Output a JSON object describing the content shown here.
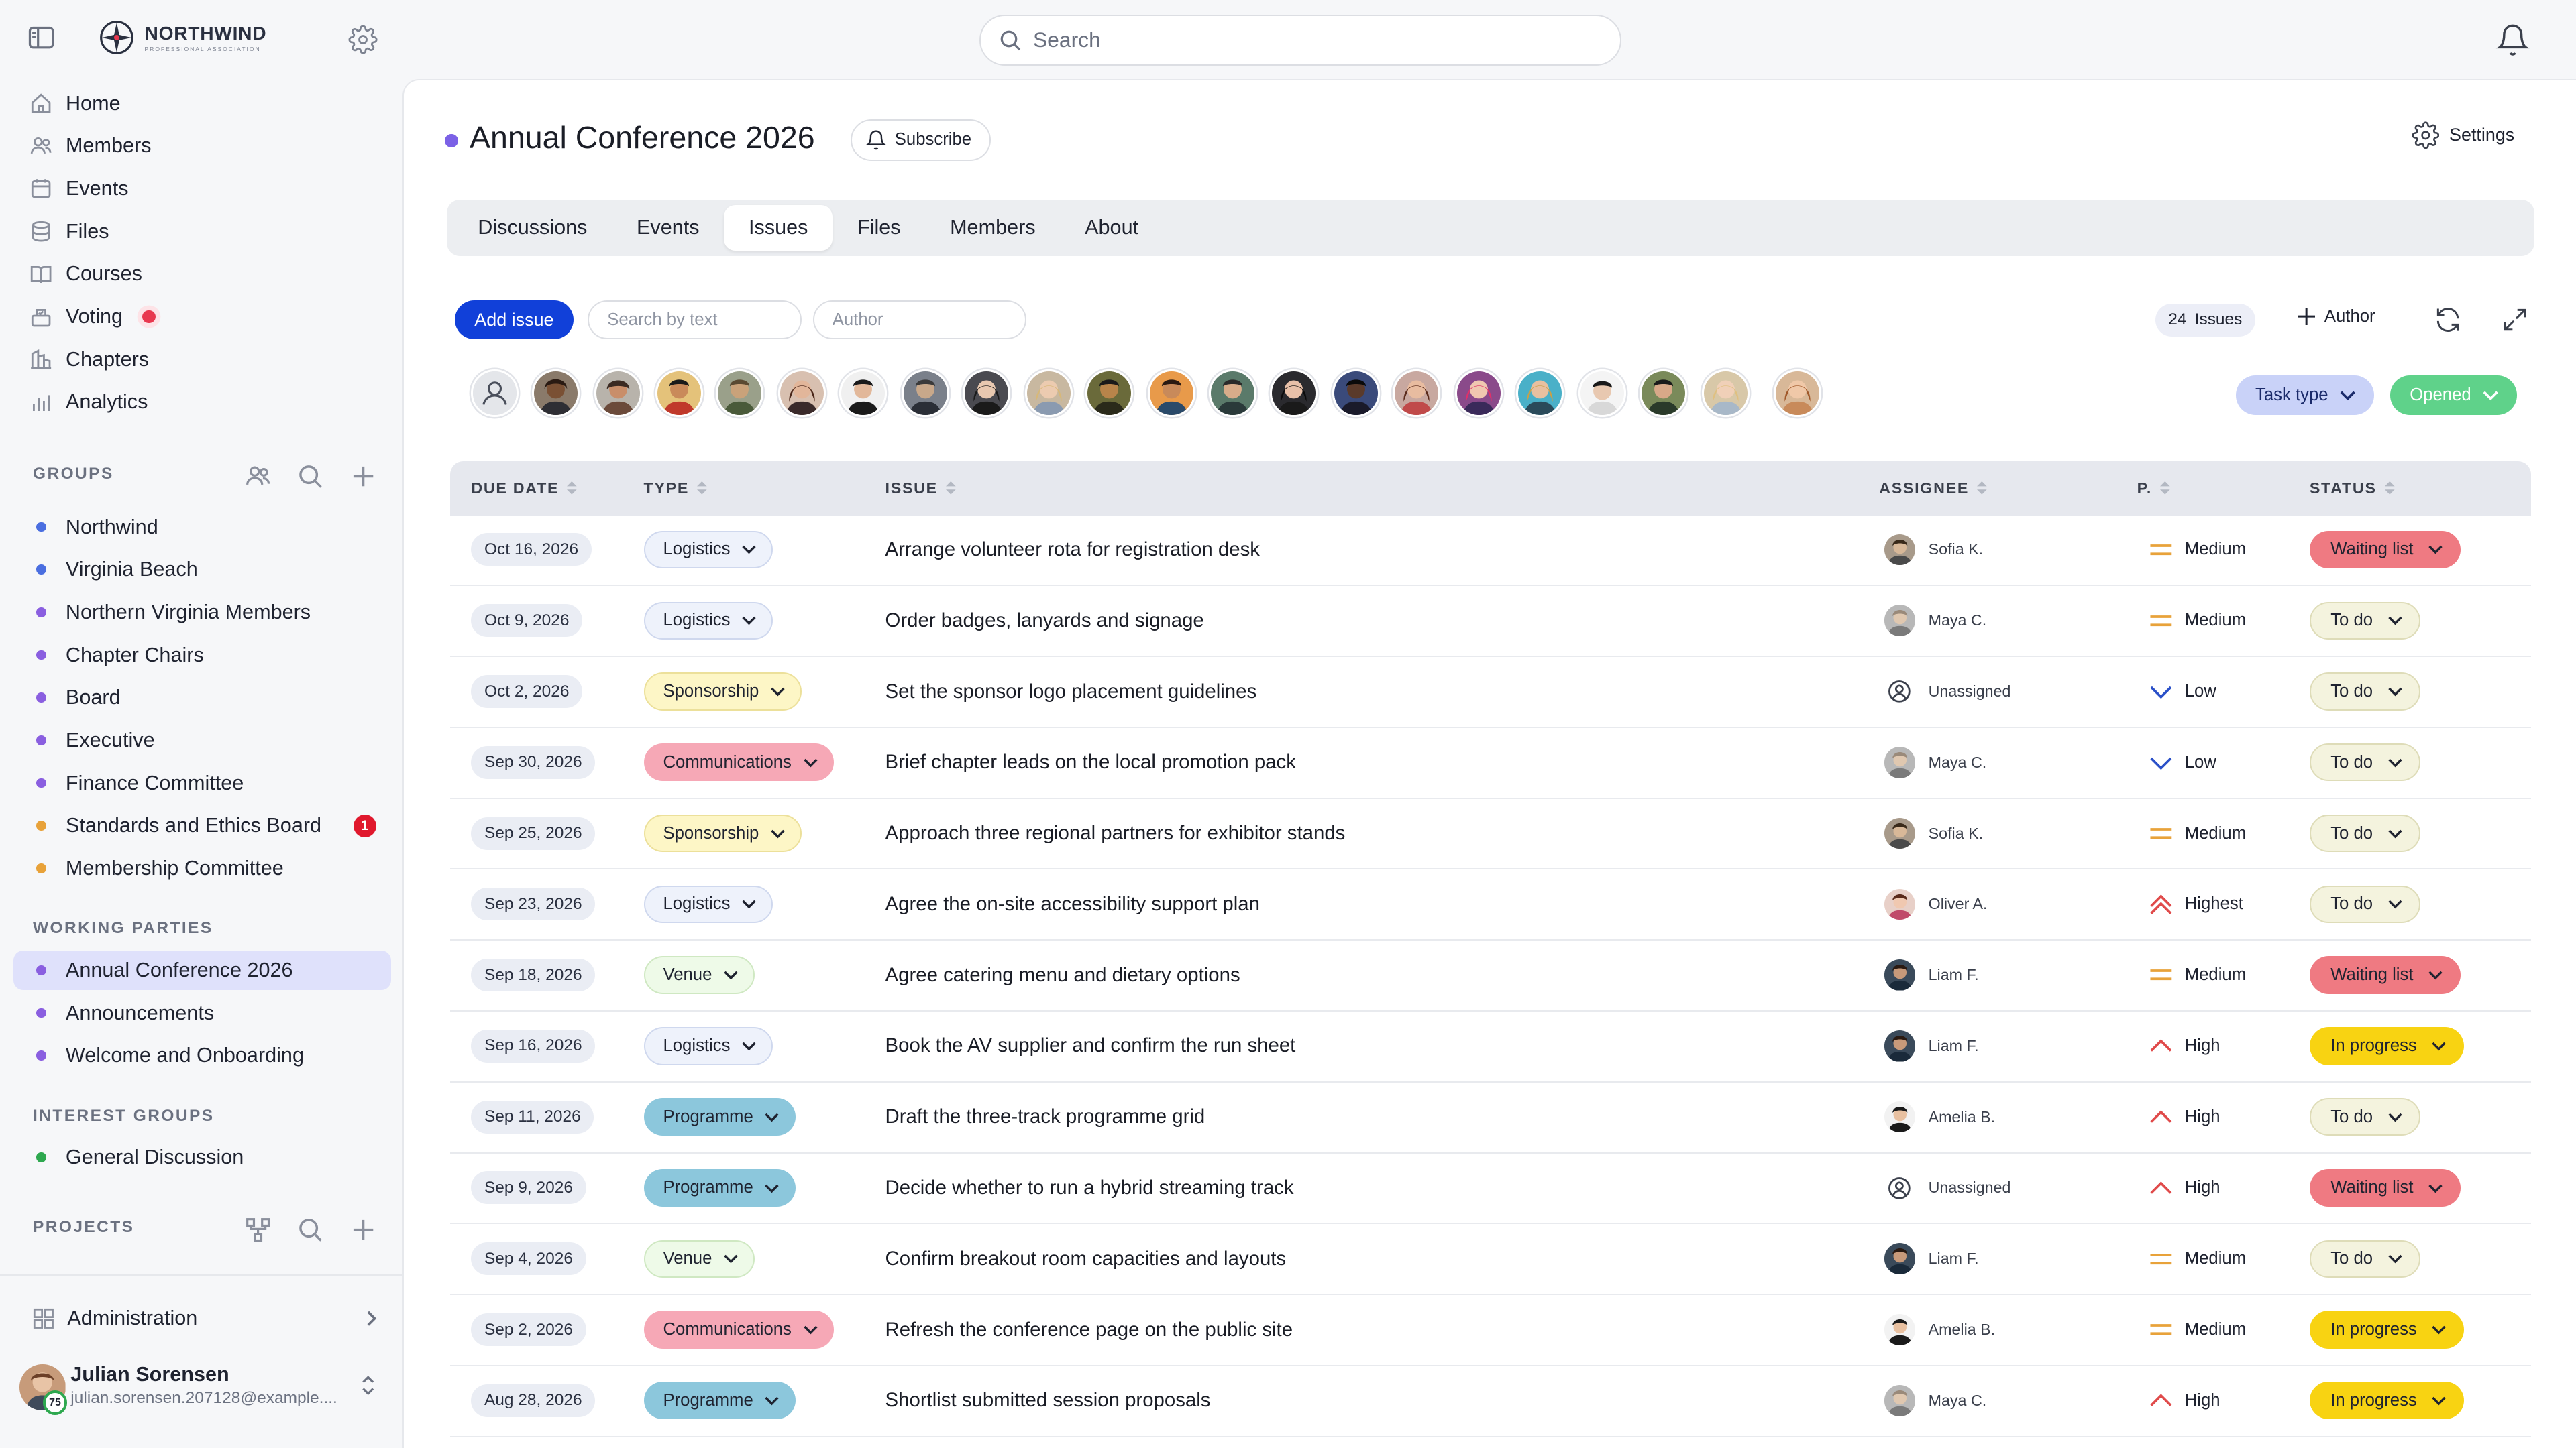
{
  "topbar": {
    "logo": {
      "name": "NORTHWIND",
      "subtitle": "PROFESSIONAL ASSOCIATION"
    },
    "search_placeholder": "Search"
  },
  "sidebar": {
    "nav": [
      {
        "label": "Home",
        "icon": "home-icon"
      },
      {
        "label": "Members",
        "icon": "members-icon"
      },
      {
        "label": "Events",
        "icon": "calendar-icon"
      },
      {
        "label": "Files",
        "icon": "files-icon"
      },
      {
        "label": "Courses",
        "icon": "book-icon"
      },
      {
        "label": "Voting",
        "icon": "ballot-icon"
      },
      {
        "label": "Chapters",
        "icon": "chapters-icon"
      },
      {
        "label": "Analytics",
        "icon": "analytics-icon"
      }
    ],
    "groups_title": "GROUPS",
    "groups": [
      {
        "label": "Northwind",
        "color": "#4a6ee0"
      },
      {
        "label": "Virginia Beach",
        "color": "#4a6ee0"
      },
      {
        "label": "Northern Virginia Members",
        "color": "#8a5fe0"
      },
      {
        "label": "Chapter Chairs",
        "color": "#8a5fe0"
      },
      {
        "label": "Board",
        "color": "#8a5fe0"
      },
      {
        "label": "Executive",
        "color": "#8a5fe0"
      },
      {
        "label": "Finance Committee",
        "color": "#8a5fe0"
      },
      {
        "label": "Standards and Ethics Board",
        "color": "#e8a23a",
        "badge": "1"
      },
      {
        "label": "Membership Committee",
        "color": "#e8a23a"
      }
    ],
    "working_parties_title": "WORKING PARTIES",
    "working_parties": [
      {
        "label": "Annual Conference 2026",
        "color": "#8a5fe0"
      },
      {
        "label": "Announcements",
        "color": "#8a5fe0"
      },
      {
        "label": "Welcome and Onboarding",
        "color": "#8a5fe0"
      }
    ],
    "interest_groups_title": "INTEREST GROUPS",
    "interest_groups": [
      {
        "label": "General Discussion",
        "color": "#2ea84f"
      }
    ],
    "projects_title": "PROJECTS",
    "administration_label": "Administration",
    "user": {
      "name": "Julian Sorensen",
      "email": "julian.sorensen.207128@example....",
      "level": "75"
    }
  },
  "page": {
    "title": "Annual Conference 2026",
    "subscribe_label": "Subscribe",
    "settings_label": "Settings",
    "tabs": [
      "Discussions",
      "Events",
      "Issues",
      "Files",
      "Members",
      "About"
    ],
    "active_tab": "Issues"
  },
  "toolbar": {
    "add_issue_label": "Add issue",
    "search_placeholder": "Search by text",
    "author_placeholder": "Author",
    "issues_count": "24",
    "issues_label": "Issues",
    "author_button": "Author",
    "task_type_filter": "Task type",
    "opened_filter": "Opened"
  },
  "table": {
    "headers": {
      "due_date": "DUE DATE",
      "type": "TYPE",
      "issue": "ISSUE",
      "assignee": "ASSIGNEE",
      "priority": "P.",
      "status": "STATUS"
    },
    "rows": [
      {
        "date": "Oct 16, 2026",
        "type": "Logistics",
        "issue": "Arrange volunteer rota for registration desk",
        "assignee": "Sofia K.",
        "priority": "Medium",
        "status": "Waiting list"
      },
      {
        "date": "Oct 9, 2026",
        "type": "Logistics",
        "issue": "Order badges, lanyards and signage",
        "assignee": "Maya C.",
        "priority": "Medium",
        "status": "To do"
      },
      {
        "date": "Oct 2, 2026",
        "type": "Sponsorship",
        "issue": "Set the sponsor logo placement guidelines",
        "assignee": "Unassigned",
        "priority": "Low",
        "status": "To do"
      },
      {
        "date": "Sep 30, 2026",
        "type": "Communications",
        "issue": "Brief chapter leads on the local promotion pack",
        "assignee": "Maya C.",
        "priority": "Low",
        "status": "To do"
      },
      {
        "date": "Sep 25, 2026",
        "type": "Sponsorship",
        "issue": "Approach three regional partners for exhibitor stands",
        "assignee": "Sofia K.",
        "priority": "Medium",
        "status": "To do"
      },
      {
        "date": "Sep 23, 2026",
        "type": "Logistics",
        "issue": "Agree the on-site accessibility support plan",
        "assignee": "Oliver A.",
        "priority": "Highest",
        "status": "To do"
      },
      {
        "date": "Sep 18, 2026",
        "type": "Venue",
        "issue": "Agree catering menu and dietary options",
        "assignee": "Liam F.",
        "priority": "Medium",
        "status": "Waiting list"
      },
      {
        "date": "Sep 16, 2026",
        "type": "Logistics",
        "issue": "Book the AV supplier and confirm the run sheet",
        "assignee": "Liam F.",
        "priority": "High",
        "status": "In progress"
      },
      {
        "date": "Sep 11, 2026",
        "type": "Programme",
        "issue": "Draft the three-track programme grid",
        "assignee": "Amelia B.",
        "priority": "High",
        "status": "To do"
      },
      {
        "date": "Sep 9, 2026",
        "type": "Programme",
        "issue": "Decide whether to run a hybrid streaming track",
        "assignee": "Unassigned",
        "priority": "High",
        "status": "Waiting list"
      },
      {
        "date": "Sep 4, 2026",
        "type": "Venue",
        "issue": "Confirm breakout room capacities and layouts",
        "assignee": "Liam F.",
        "priority": "Medium",
        "status": "To do"
      },
      {
        "date": "Sep 2, 2026",
        "type": "Communications",
        "issue": "Refresh the conference page on the public site",
        "assignee": "Amelia B.",
        "priority": "Medium",
        "status": "In progress"
      },
      {
        "date": "Aug 28, 2026",
        "type": "Programme",
        "issue": "Shortlist submitted session proposals",
        "assignee": "Maya C.",
        "priority": "High",
        "status": "In progress"
      }
    ]
  },
  "colors": {
    "accent": "#1140d9",
    "type_logistics": "#eef2fb",
    "type_sponsorship": "#fdf6c6",
    "type_communications": "#f6a8b6",
    "type_venue": "#eefae8",
    "type_programme": "#8cc7dc",
    "status_waiting": "#ef7a82",
    "status_todo": "#f4f3de",
    "status_progress": "#f8d312",
    "task_type_bg": "#c9d2f8",
    "opened_bg": "#5fd28a"
  }
}
